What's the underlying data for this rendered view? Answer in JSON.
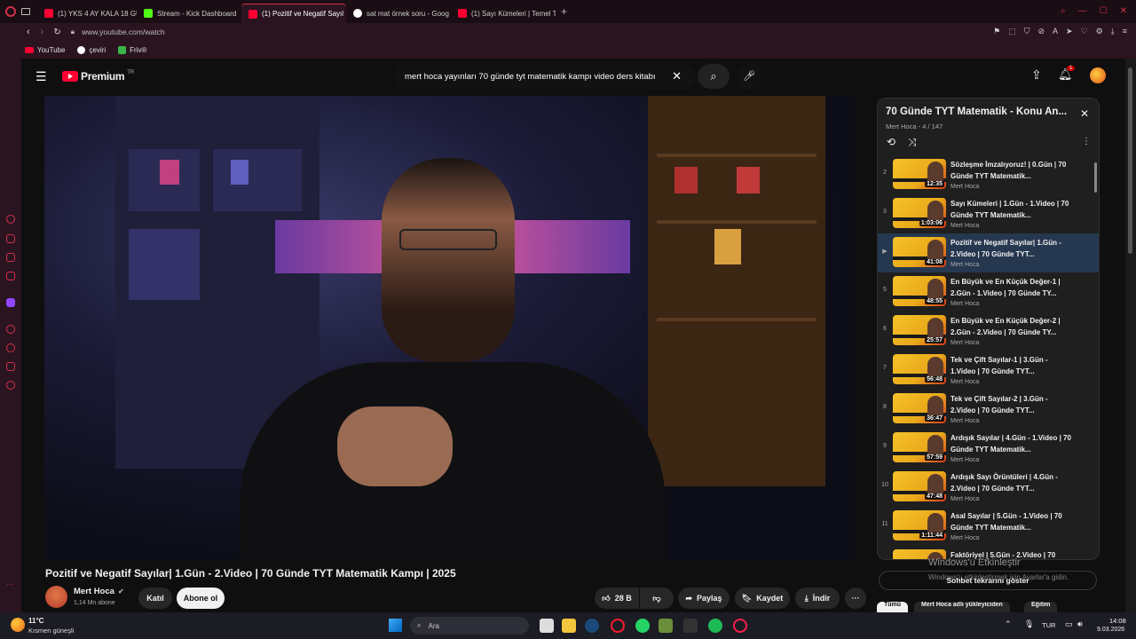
{
  "browser": {
    "tabs": [
      {
        "label": "(1) YKS 4 AY KALA 18 GÜN",
        "icon": "youtube-icon"
      },
      {
        "label": "Stream - Kick Dashboard",
        "icon": "kick-icon"
      },
      {
        "label": "(1) Pozitif ve Negatif Sayıl",
        "icon": "youtube-icon",
        "active": true
      },
      {
        "label": "sat mat örnek soru - Goog",
        "icon": "google-icon"
      },
      {
        "label": "(1) Sayı Kümeleri | Temel T",
        "icon": "youtube-icon"
      }
    ],
    "url": "www.youtube.com/watch",
    "bookmarks": [
      {
        "label": "YouTube",
        "icon": "youtube-icon"
      },
      {
        "label": "çeviri",
        "icon": "google-icon"
      },
      {
        "label": "Friv®",
        "icon": "friv-icon"
      }
    ]
  },
  "youtube": {
    "logo_text": "Premium",
    "logo_sup": "TR",
    "search_value": "mert hoca yayınları 70 günde tyt matematik kampı video ders kitabı",
    "notification_count": "1"
  },
  "video": {
    "title": "Pozitif ve Negatif Sayılar| 1.Gün - 2.Video | 70 Günde TYT Matematik Kampı | 2025",
    "channel": "Mert Hoca",
    "subscribers": "1,14 Mn abone",
    "join_label": "Katıl",
    "subscribe_label": "Abone ol",
    "likes": "28 B",
    "share_label": "Paylaş",
    "save_label": "Kaydet",
    "download_label": "İndir"
  },
  "playlist": {
    "title": "70 Günde TYT Matematik - Konu An...",
    "meta": "Mert Hoca - 4 / 147",
    "items": [
      {
        "index": "2",
        "title": "Sözleşme İmzalıyoruz! | 0.Gün | 70 Günde TYT Matematik...",
        "channel": "Mert Hoca",
        "duration": "12:35"
      },
      {
        "index": "3",
        "title": "Sayı Kümeleri | 1.Gün - 1.Video | 70 Günde TYT Matematik...",
        "channel": "Mert Hoca",
        "duration": "1:03:06"
      },
      {
        "index": "▶",
        "title": "Pozitif ve Negatif Sayılar| 1.Gün - 2.Video | 70 Günde TYT...",
        "channel": "Mert Hoca",
        "duration": "41:08"
      },
      {
        "index": "5",
        "title": "En Büyük ve En Küçük Değer-1 | 2.Gün - 1.Video | 70 Günde TY...",
        "channel": "Mert Hoca",
        "duration": "48:55"
      },
      {
        "index": "6",
        "title": "En Büyük ve En Küçük Değer-2 | 2.Gün - 2.Video | 70 Günde TY...",
        "channel": "Mert Hoca",
        "duration": "25:57"
      },
      {
        "index": "7",
        "title": "Tek ve Çift Sayılar-1 | 3.Gün - 1.Video | 70 Günde TYT...",
        "channel": "Mert Hoca",
        "duration": "56:48"
      },
      {
        "index": "8",
        "title": "Tek ve Çift Sayılar-2 | 3.Gün - 2.Video | 70 Günde TYT...",
        "channel": "Mert Hoca",
        "duration": "36:47"
      },
      {
        "index": "9",
        "title": "Ardışık Sayılar | 4.Gün - 1.Video | 70 Günde TYT Matematik...",
        "channel": "Mert Hoca",
        "duration": "57:59"
      },
      {
        "index": "10",
        "title": "Ardışık Sayı Örüntüleri | 4.Gün - 2.Video | 70 Günde TYT...",
        "channel": "Mert Hoca",
        "duration": "47:48"
      },
      {
        "index": "11",
        "title": "Asal Sayılar | 5.Gün - 1.Video | 70 Günde TYT Matematik...",
        "channel": "Mert Hoca",
        "duration": "1:11:44"
      },
      {
        "index": "12",
        "title": "Faktöriyel | 5.Gün - 2.Video | 70",
        "channel": "",
        "duration": ""
      }
    ]
  },
  "sidebar_below": {
    "chat_button": "Sohbet tekrarını göster",
    "chips": [
      "Tümü",
      "Mert Hoca adlı yükleyiciden",
      "Eğitim"
    ]
  },
  "watermark": {
    "line1": "Windows'u Etkinleştir",
    "line2": "Windows'u etkinleştirmek için Ayarlar'a gidin."
  },
  "taskbar": {
    "weather_temp": "11°C",
    "weather_desc": "Kısmen güneşli",
    "search_placeholder": "Ara",
    "lang": "TUR",
    "time": "14:08",
    "date": "9.03.2026"
  },
  "colors": {
    "accent_red": "#ff0033",
    "opera_red": "#d4304a",
    "playlist_current": "#263850"
  }
}
